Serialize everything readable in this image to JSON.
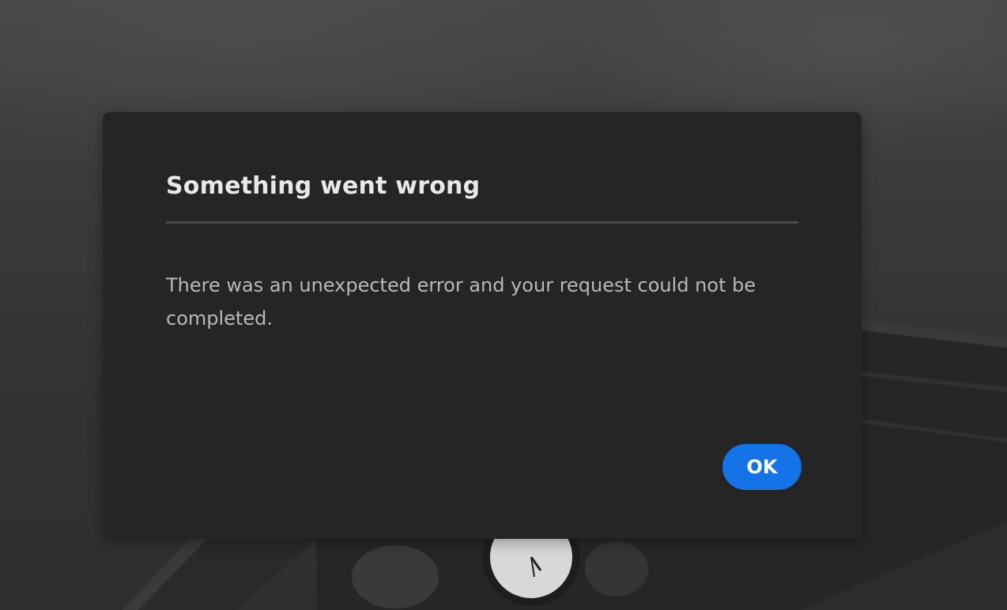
{
  "dialog": {
    "title": "Something went wrong",
    "message": "There was an unexpected error and your request could not be completed.",
    "ok_label": "OK"
  },
  "colors": {
    "accent": "#1473e6",
    "dialog_background": "#252525",
    "title_text": "#e8e8e8",
    "body_text": "#b9b9b9"
  }
}
